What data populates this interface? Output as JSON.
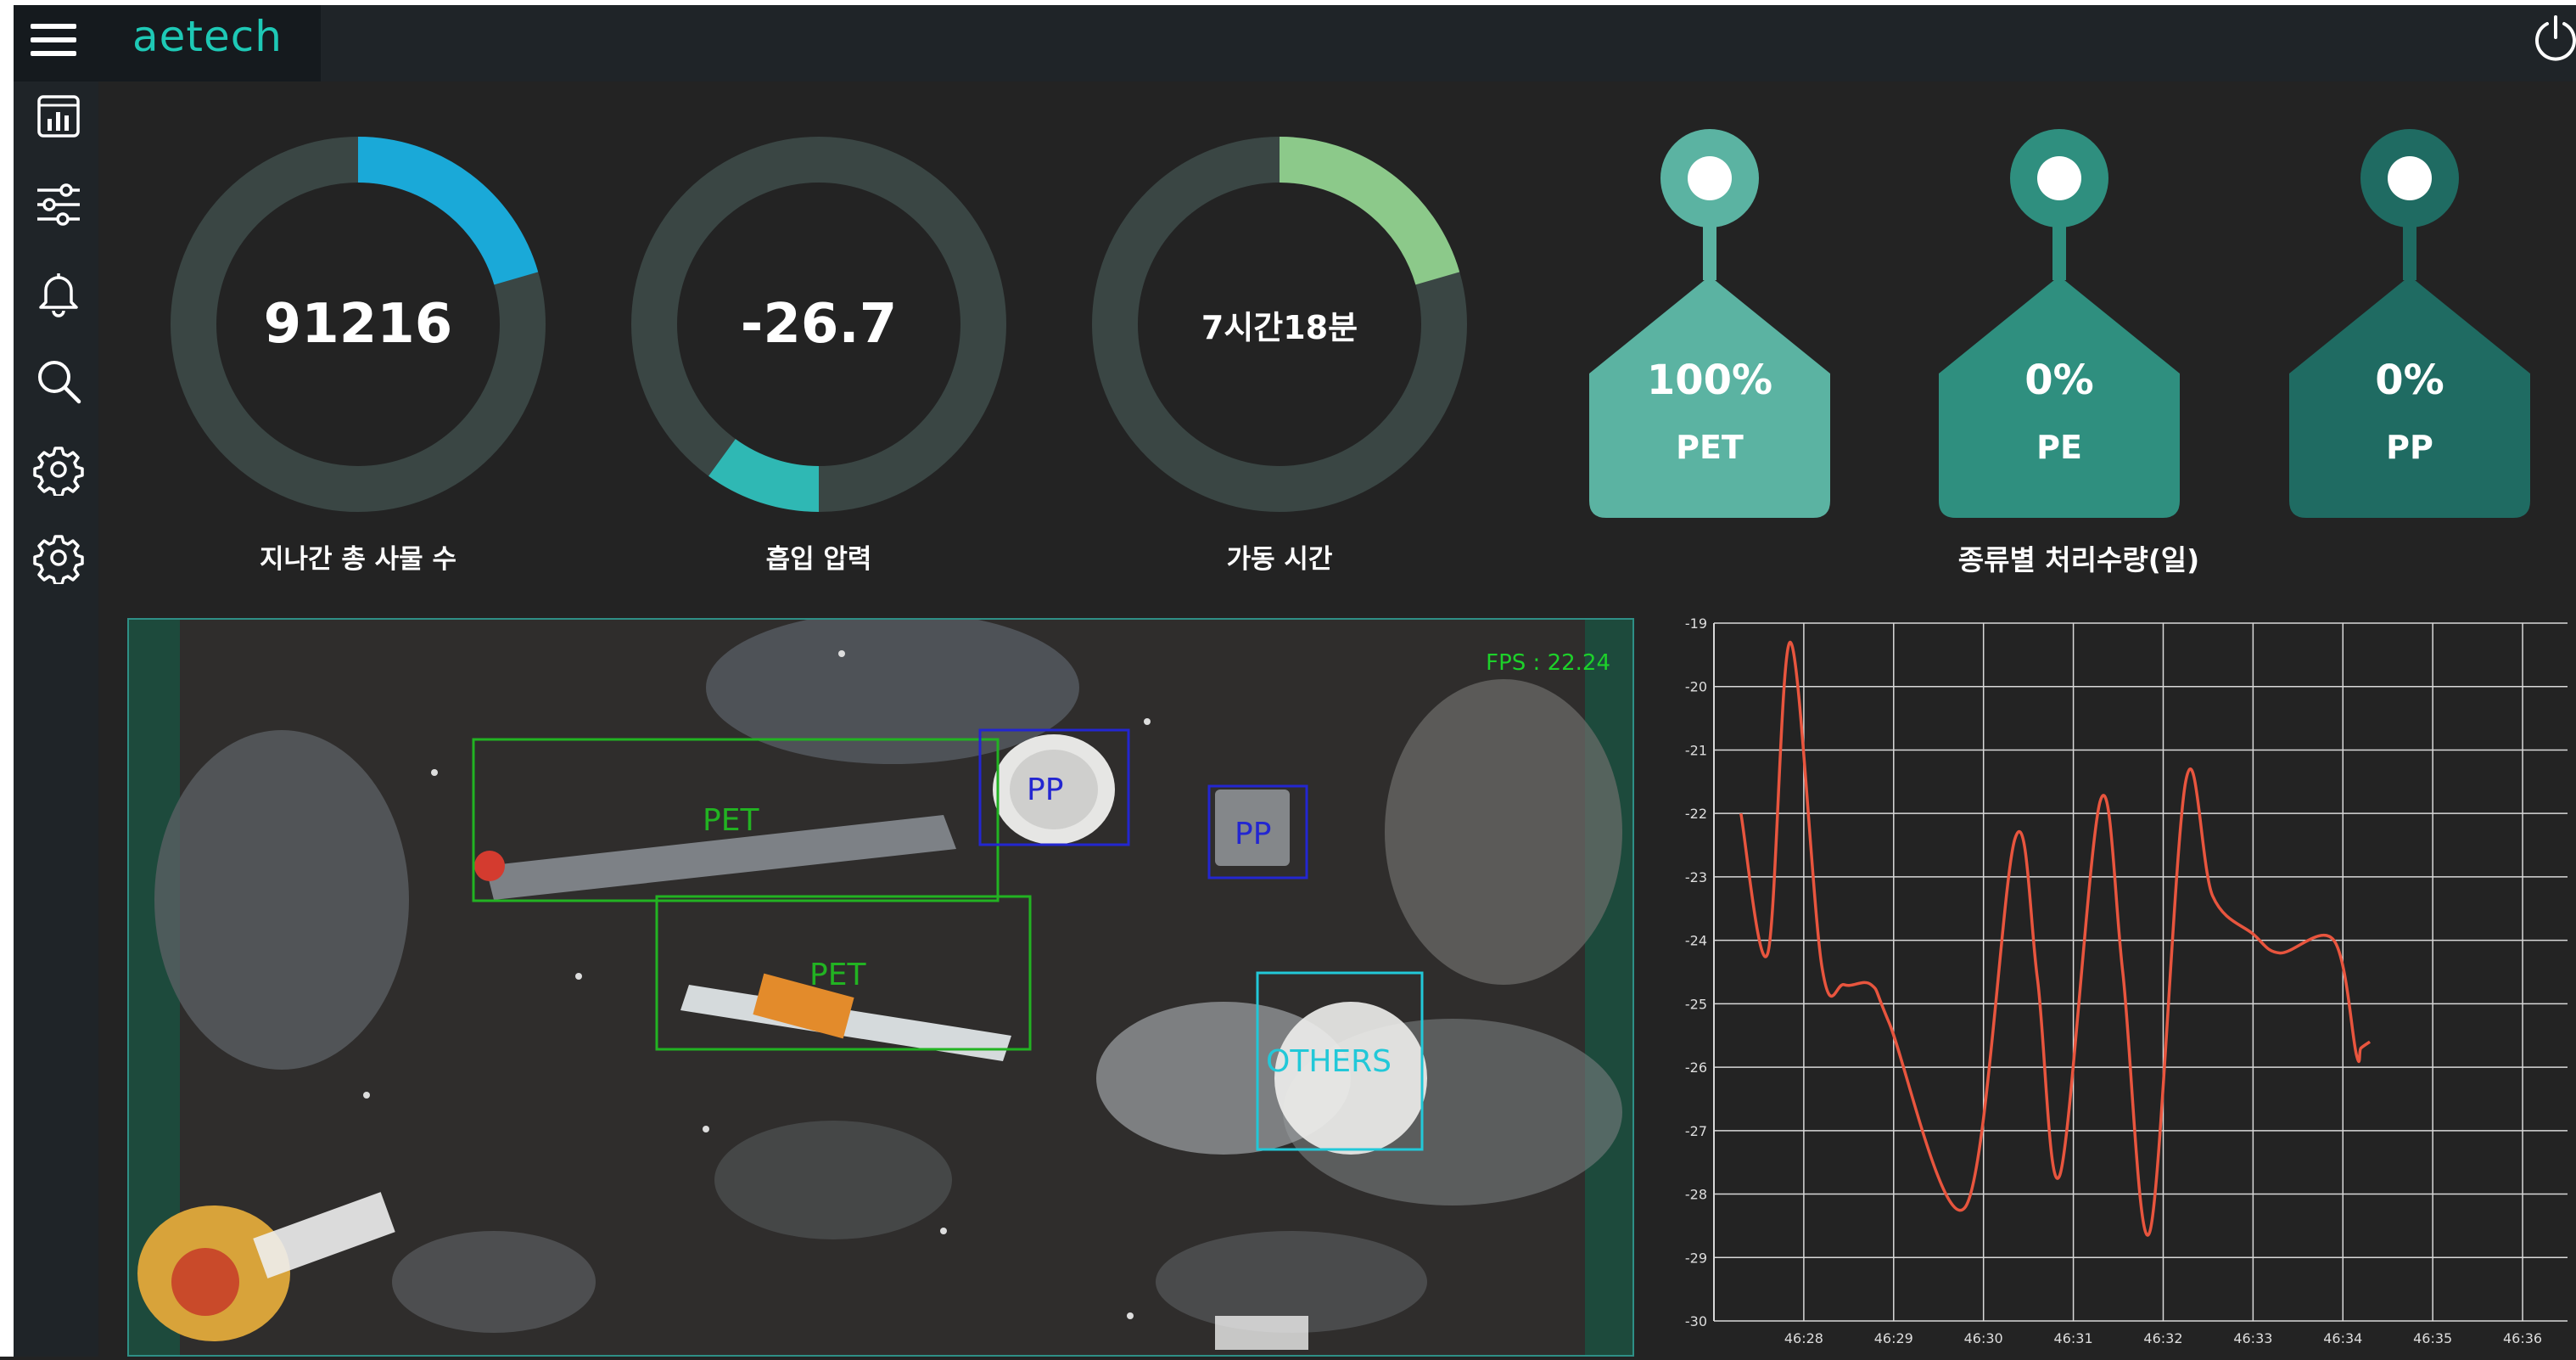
{
  "app": {
    "brand": "aetech",
    "menu_icon": "hamburger-menu-icon",
    "power_icon": "power-icon",
    "accent_color": "#1ec9b6"
  },
  "sidebar": {
    "items": [
      {
        "icon": "dashboard-chart-icon"
      },
      {
        "icon": "sliders-settings-icon"
      },
      {
        "icon": "bell-notification-icon"
      },
      {
        "icon": "search-icon"
      },
      {
        "icon": "gear-icon"
      },
      {
        "icon": "gear-icon"
      }
    ]
  },
  "gauges": [
    {
      "value": "91216",
      "label": "지나간 총 사물 수",
      "fill_fraction": 0.205,
      "direction": "clockwise",
      "color_start": "#1aa9d8",
      "color_end": "#19c3e8"
    },
    {
      "value": "-26.7",
      "label": "흡입 압력",
      "fill_fraction": 0.1,
      "direction": "counterclockwise-from-bottom",
      "color_start": "#2fb8b4",
      "color_end": "#6fe0d8"
    },
    {
      "value": "7시간18분",
      "label": "가동 시간",
      "fill_fraction": 0.205,
      "direction": "clockwise",
      "color_start": "#8cc98a",
      "color_end": "#5ea760"
    }
  ],
  "material_tags": {
    "label": "종류별 처리수량(일)",
    "items": [
      {
        "percent": "100%",
        "name": "PET",
        "color": "#5bb3a2"
      },
      {
        "percent": "0%",
        "name": "PE",
        "color": "#2f8f7f"
      },
      {
        "percent": "0%",
        "name": "PP",
        "color": "#1f6b62"
      }
    ]
  },
  "camera": {
    "fps_text": "FPS : 22.24",
    "detections": [
      {
        "label": "PET",
        "color": "#22b322"
      },
      {
        "label": "PP",
        "color": "#2326d1"
      },
      {
        "label": "PP",
        "color": "#2326d1"
      },
      {
        "label": "PET",
        "color": "#22b322"
      },
      {
        "label": "OTHERS",
        "color": "#22c8d8"
      }
    ]
  },
  "chart_data": {
    "type": "line",
    "title": "",
    "xlabel": "",
    "ylabel": "",
    "ylim": [
      -30,
      -19
    ],
    "y_ticks": [
      -19,
      -20,
      -21,
      -22,
      -23,
      -24,
      -25,
      -26,
      -27,
      -28,
      -29,
      -30
    ],
    "x_ticks": [
      "46:28",
      "46:29",
      "46:30",
      "46:31",
      "46:32",
      "46:33",
      "46:34",
      "46:35",
      "46:36"
    ],
    "grid": true,
    "line_color": "#e8553e",
    "series": [
      {
        "values": [
          {
            "t": 27.3,
            "y": -22.0
          },
          {
            "t": 27.6,
            "y": -24.2
          },
          {
            "t": 27.85,
            "y": -19.3
          },
          {
            "t": 28.2,
            "y": -24.4
          },
          {
            "t": 28.45,
            "y": -24.7
          },
          {
            "t": 28.75,
            "y": -24.7
          },
          {
            "t": 28.95,
            "y": -25.3
          },
          {
            "t": 29.8,
            "y": -28.2
          },
          {
            "t": 30.35,
            "y": -22.4
          },
          {
            "t": 30.6,
            "y": -24.6
          },
          {
            "t": 30.85,
            "y": -27.7
          },
          {
            "t": 31.3,
            "y": -21.8
          },
          {
            "t": 31.55,
            "y": -24.5
          },
          {
            "t": 31.85,
            "y": -28.6
          },
          {
            "t": 32.25,
            "y": -21.5
          },
          {
            "t": 32.55,
            "y": -23.3
          },
          {
            "t": 33.0,
            "y": -23.9
          },
          {
            "t": 33.3,
            "y": -24.2
          },
          {
            "t": 33.9,
            "y": -24.0
          },
          {
            "t": 34.15,
            "y": -25.8
          },
          {
            "t": 34.2,
            "y": -25.7
          },
          {
            "t": 34.3,
            "y": -25.6
          }
        ]
      }
    ]
  }
}
